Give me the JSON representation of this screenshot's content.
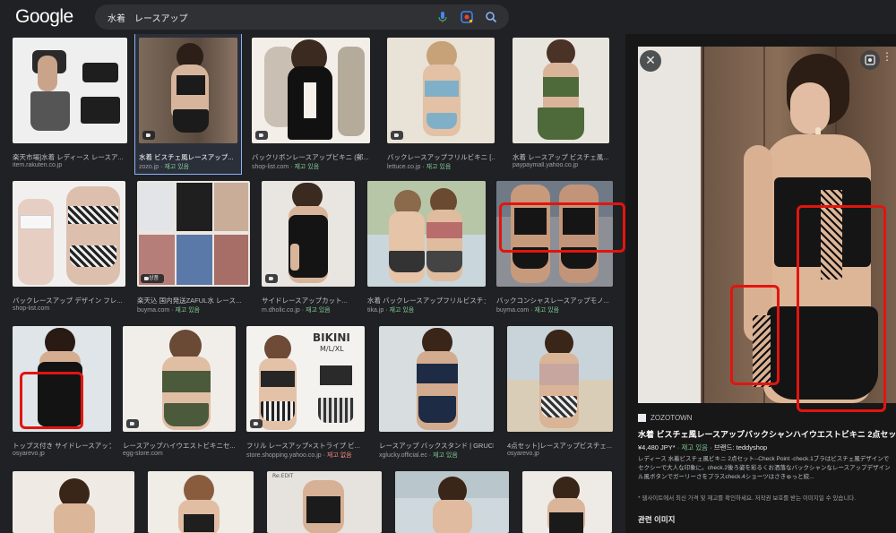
{
  "header": {
    "logo": "Google",
    "search_value": "水着　レースアップ"
  },
  "results": [
    {
      "title": "楽天市場]水着 レディース レースア...",
      "source": "item.rakuten.co.jp",
      "tag": ""
    },
    {
      "title": "水着 ビスチェ風レースアップ...",
      "source": "zozo.jp",
      "tag": "· 재고 있음"
    },
    {
      "title": "バックリボンレースアップビキニ (郵...",
      "source": "shop-list.com",
      "tag": "· 재고 있음"
    },
    {
      "title": "バックレースアップフリルビキニ [...",
      "source": "lettuce.co.jp",
      "tag": "· 재고 있음"
    },
    {
      "title": "水着 レースアップ ビスチェ風...",
      "source": "paypaymall.yahoo.co.jp",
      "tag": ""
    },
    {
      "title": "バックレースアップ デザイン フレ...",
      "source": "shop-list.com",
      "tag": ""
    },
    {
      "title": "楽天込 国内発送ZAFUL水 レース...",
      "source": "buyma.com",
      "tag": "· 재고 있음"
    },
    {
      "title": "サイドレースアップカット...",
      "source": "m.dholic.co.jp",
      "tag": "· 재고 있음"
    },
    {
      "title": "水着 バックレースアップフリルビスチェ...",
      "source": "tika.jp",
      "tag": "· 재고 있음"
    },
    {
      "title": "バックコンシャスレースアップモノ...",
      "source": "buyma.com",
      "tag": "· 재고 있음"
    },
    {
      "title": "トップス付き サイドレースアップ...",
      "source": "osyarevo.jp",
      "tag": ""
    },
    {
      "title": "レースアップハイウエストビキニセ...",
      "source": "egg-store.com",
      "tag": ""
    },
    {
      "title": "フリル レースアップ×ストライプ ビ...",
      "source": "store.shopping.yahoo.co.jp",
      "tag": "· 재고 없음"
    },
    {
      "title": "レースアップ バックスタンド | GRUCK",
      "source": "xglucky.official.ec",
      "tag": "· 재고 있음"
    },
    {
      "title": "4点セット]レースアップビスチェ...",
      "source": "osyarevo.jp",
      "tag": ""
    }
  ],
  "badges": {
    "gift": "상품"
  },
  "thumb_text": {
    "bikini": "BIKINI",
    "bikini_size": "M/L/XL",
    "brand": "Re:EDIT"
  },
  "panel": {
    "close": "✕",
    "more": "⋮",
    "source": "ZOZOTOWN",
    "title": "水着 ビスチェ風レースアップバックシャンハイウエストビキニ 2点セット",
    "price": "¥4,480 JPY*",
    "stock": "· 재고 있음",
    "brand": "· 브랜드: teddyshop",
    "desc_lines": [
      "レディース 水着ビスチェ風ビキニ 2点セット--Check Point -check.1ブラはビスチェ風デザインで",
      "セクシーで大人な印象に。check.2後ろ姿を彩るくお洒落なバックシャンなレースアップデザイン",
      "ル風ボタンでガーリーさをプラスcheck.4ショーツはさきゅっと絞..."
    ],
    "notice": "* 웹사이트에서 최신 가격 및 재고를 확인하세요. 저작권 보호를 받는 이미지일 수 있습니다.",
    "related": "관련 이미지"
  },
  "colors": {
    "background": "#202124",
    "panel": "#171717",
    "accent": "#8ab4f8",
    "in_stock": "#81c995",
    "highlight_box": "#e3140f"
  }
}
